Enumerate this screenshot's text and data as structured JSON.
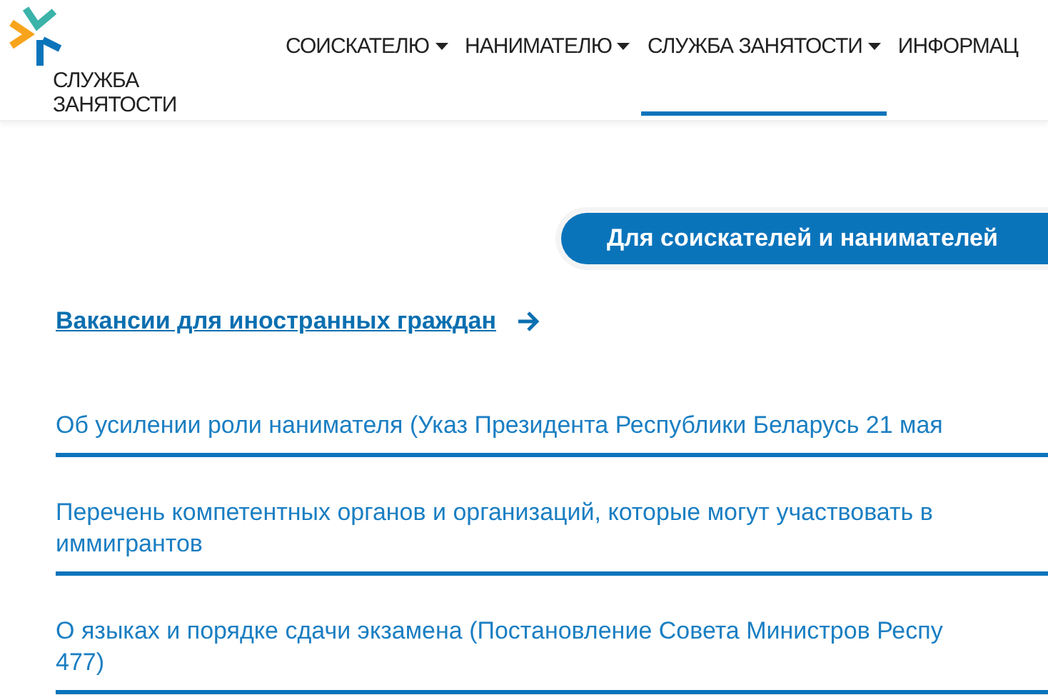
{
  "logo": {
    "lines": [
      "СЛУЖБА",
      "ЗАНЯТОСТИ"
    ]
  },
  "nav": [
    {
      "label": "СОИСКАТЕЛЮ",
      "dropdown": true,
      "selected": false
    },
    {
      "label": "НАНИМАТЕЛЮ",
      "dropdown": true,
      "selected": false
    },
    {
      "label": "СЛУЖБА ЗАНЯТОСТИ",
      "dropdown": true,
      "selected": true
    },
    {
      "label": "ИНФОРМАЦ",
      "dropdown": false,
      "selected": false
    }
  ],
  "section_button": "Для соискателей и нанимателей",
  "featured_link": "Вакансии для иностранных граждан",
  "documents": [
    {
      "text": "Об усилении роли нанимателя (Указ Президента Республики Беларусь 21 мая"
    },
    {
      "text": "Перечень компетентных органов и организаций, которые могут участвовать в\nиммигрантов"
    },
    {
      "text": "О языках и порядке сдачи экзамена (Постановление Совета Министров Респу\n477)"
    }
  ]
}
